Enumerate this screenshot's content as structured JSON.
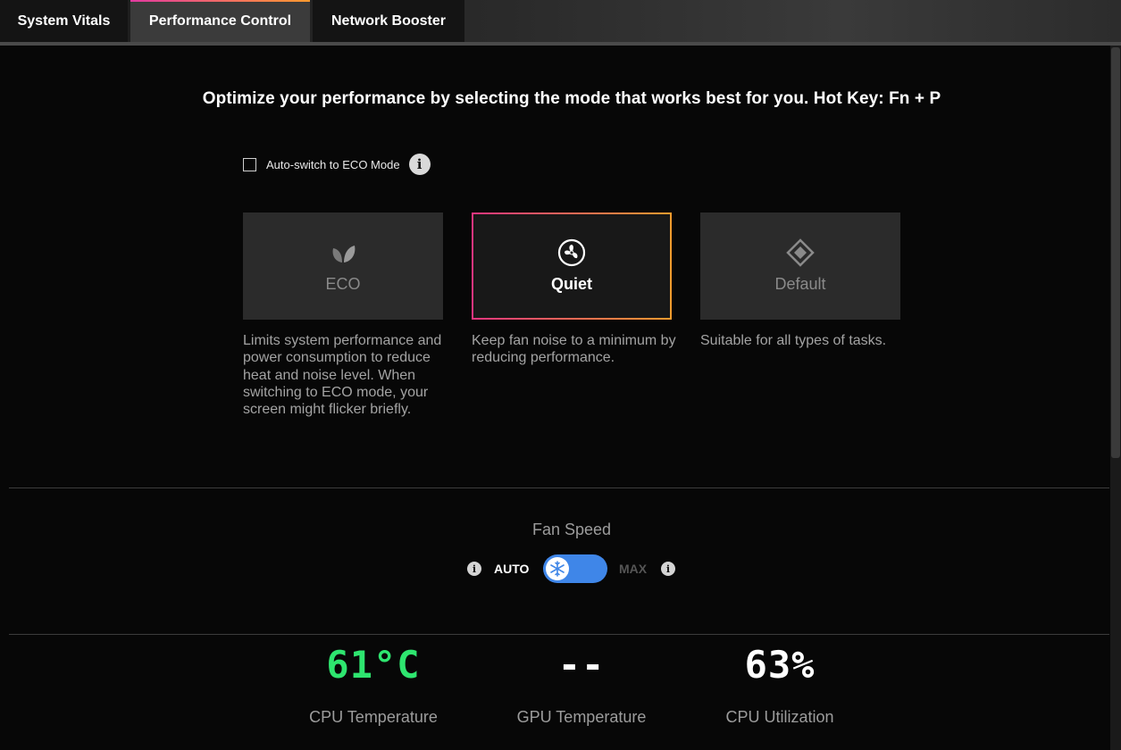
{
  "tabs": [
    {
      "label": "System Vitals",
      "active": false
    },
    {
      "label": "Performance Control",
      "active": true
    },
    {
      "label": "Network Booster",
      "active": false
    }
  ],
  "headline": "Optimize your performance by selecting the mode that works best for you.  Hot Key: Fn + P",
  "auto_switch": {
    "label": "Auto-switch to ECO Mode",
    "checked": false,
    "info_glyph": "i"
  },
  "modes": [
    {
      "label": "ECO",
      "icon": "leaf-icon",
      "selected": false,
      "description": "Limits system performance and power consumption to reduce heat and noise level. When switching to ECO mode, your screen might flicker briefly."
    },
    {
      "label": "Quiet",
      "icon": "fan-icon",
      "selected": true,
      "description": "Keep fan noise to a minimum by reducing performance."
    },
    {
      "label": "Default",
      "icon": "diamond-icon",
      "selected": false,
      "description": "Suitable for all types of tasks."
    }
  ],
  "fan_speed": {
    "title": "Fan Speed",
    "auto_label": "AUTO",
    "max_label": "MAX",
    "value": "AUTO",
    "info_glyph": "i"
  },
  "stats": [
    {
      "value": "61°C",
      "label": "CPU Temperature",
      "color": "#2ee56f"
    },
    {
      "value": "--",
      "label": "GPU Temperature",
      "color": "#ffffff"
    },
    {
      "value": "63%",
      "label": "CPU Utilization",
      "color": "#ffffff"
    }
  ],
  "colors": {
    "accent_gradient_start": "#e5357f",
    "accent_gradient_end": "#ff9c2e",
    "toggle": "#3f86e8"
  }
}
